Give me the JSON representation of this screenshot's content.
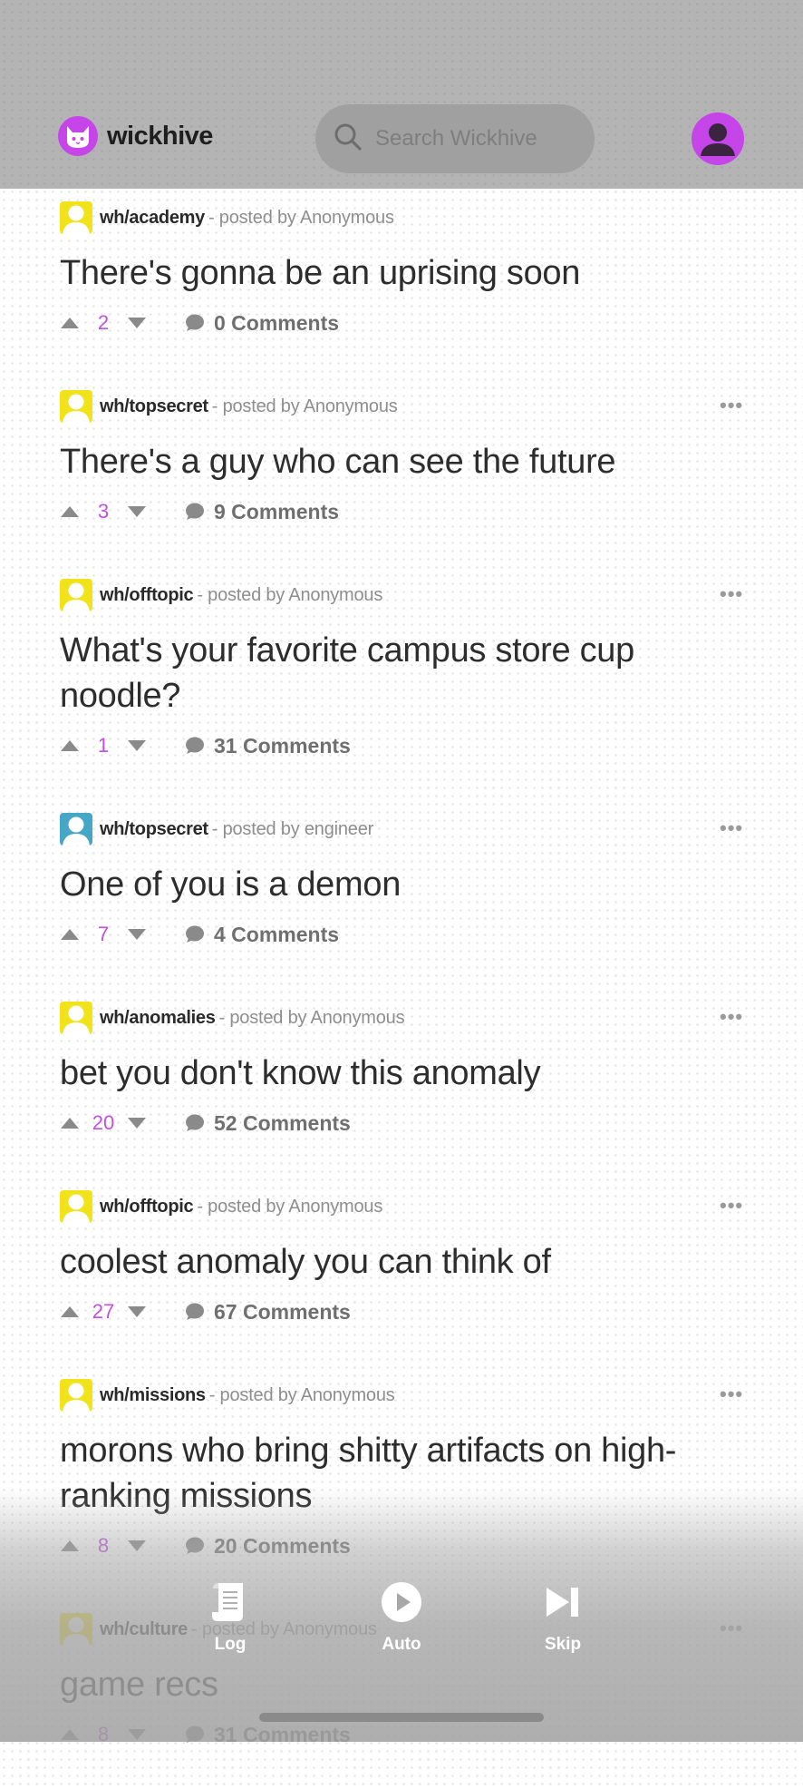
{
  "app": {
    "brand": "wickhive",
    "search_placeholder": "Search Wickhive"
  },
  "colors": {
    "accent": "#c545e8",
    "score": "#c24fe0",
    "sub_yellow": "#f2e21a",
    "sub_blue": "#45a6c6"
  },
  "posts": [
    {
      "sub": "wh/academy",
      "posted_by": "- posted by Anonymous",
      "title": "There's gonna be an uprising soon",
      "score": "2",
      "comments": "0 Comments",
      "icon_color": "yellow"
    },
    {
      "sub": "wh/topsecret",
      "posted_by": "- posted by Anonymous",
      "title": "There's a guy who can see the future",
      "score": "3",
      "comments": "9 Comments",
      "icon_color": "yellow"
    },
    {
      "sub": "wh/offtopic",
      "posted_by": "- posted by Anonymous",
      "title": "What's your favorite campus store cup noodle?",
      "score": "1",
      "comments": "31 Comments",
      "icon_color": "yellow"
    },
    {
      "sub": "wh/topsecret",
      "posted_by": "- posted by engineer",
      "title": "One of you is a demon",
      "score": "7",
      "comments": "4 Comments",
      "icon_color": "blue"
    },
    {
      "sub": "wh/anomalies",
      "posted_by": "- posted by Anonymous",
      "title": "bet you don't know this anomaly",
      "score": "20",
      "comments": "52 Comments",
      "icon_color": "yellow"
    },
    {
      "sub": "wh/offtopic",
      "posted_by": "- posted by Anonymous",
      "title": "coolest anomaly you can think of",
      "score": "27",
      "comments": "67 Comments",
      "icon_color": "yellow"
    },
    {
      "sub": "wh/missions",
      "posted_by": "- posted by Anonymous",
      "title": "morons who bring shitty artifacts on high-ranking missions",
      "score": "8",
      "comments": "20 Comments",
      "icon_color": "yellow"
    },
    {
      "sub": "wh/culture",
      "posted_by": "- posted by Anonymous",
      "title": "game recs",
      "score": "8",
      "comments": "31 Comments",
      "icon_color": "yellow"
    }
  ],
  "dock": {
    "log_label": "Log",
    "auto_label": "Auto",
    "skip_label": "Skip"
  }
}
